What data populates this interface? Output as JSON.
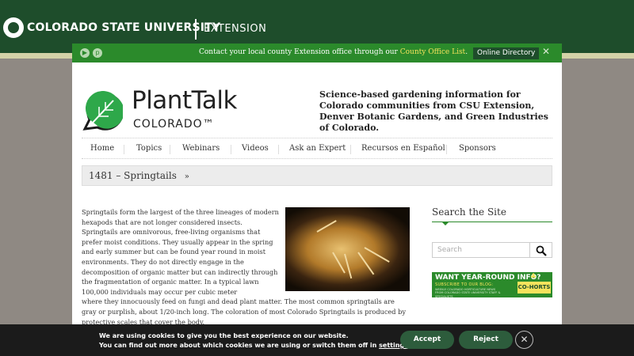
{
  "csu_header": {
    "university": "COLORADO STATE UNIVERSITY",
    "unit": "EXTENSION"
  },
  "notice_bar": {
    "text": "Contact your local county Extension office through our",
    "link": "County Office List",
    "suffix": ".",
    "directory_button": "Online Directory",
    "close_glyph": "✕",
    "social_icons": [
      "youtube-icon",
      "pinterest-icon"
    ]
  },
  "logo": {
    "title": "PlantTalk",
    "subtitle": "COLORADO™"
  },
  "tagline": "Science-based gardening information for Colorado communities from CSU Extension, Denver Botanic Gardens, and Green Industries of Colorado.",
  "nav": {
    "items": [
      "Home",
      "Topics",
      "Webinars",
      "Videos",
      "Ask an Expert",
      "Recursos en Español",
      "Sponsors"
    ]
  },
  "breadcrumb": {
    "title": "1481 – Springtails",
    "arrow": "»"
  },
  "article": {
    "p1_narrow": "Springtails form the largest of the three lineages of modern hexapods that are not longer considered insects. Springtails are omnivorous, free-living organisms that prefer moist conditions. They usually appear in the spring and early summer but can be found year round in moist environments. They do not directly engage in the decomposition of organic matter but can indirectly through the fragmentation of organic matter. In a typical lawn 100,000 individuals may occur per cubic meter",
    "p1_wide": "where they innocuously feed on fungi and dead plant matter. The most common springtails are gray or purplish, about 1/20-inch long. The coloration of most Colorado Springtails is produced by protective scales that cover the body."
  },
  "sidebar": {
    "title": "Search the Site",
    "search_placeholder": "Search",
    "banner": {
      "headline": "WANT YEAR-ROUND INFO?",
      "subline": "SUBSCRIBE TO OUR BLOG:",
      "detail": "WEEKLY COLORADO HORTICULTURE NEWS FROM COLORADO STATE UNIVERSITY STAFF & SPECIALISTS",
      "logo": "CO-HORTS"
    }
  },
  "cookie_bar": {
    "line1": "We are using cookies to give you the best experience on our website.",
    "line2": "You can find out more about which cookies we are using or switch them off in",
    "link": "settings",
    "suffix": ".",
    "accept": "Accept",
    "reject": "Reject",
    "close_glyph": "✕"
  },
  "colors": {
    "csu_green": "#1e4d2b",
    "bar_green": "#2b8a2b",
    "gold": "#f5e35c"
  }
}
